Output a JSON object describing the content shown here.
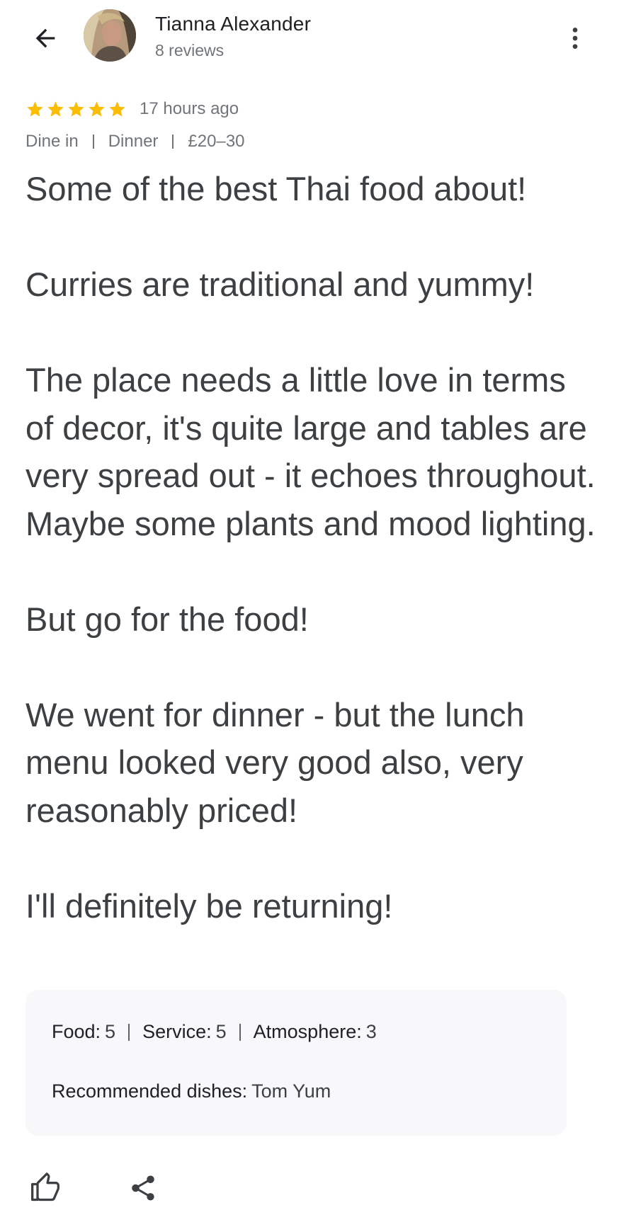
{
  "header": {
    "user_name": "Tianna Alexander",
    "review_count": "8 reviews",
    "back_icon": "arrow-left-icon",
    "more_icon": "more-vertical-icon"
  },
  "rating": {
    "stars": 5,
    "star_color": "#fbbc04",
    "time_ago": "17 hours ago"
  },
  "meta": {
    "items": [
      "Dine in",
      "Dinner",
      "£20–30"
    ]
  },
  "review": {
    "paragraphs": [
      "Some of the best Thai food about!",
      "Curries are traditional and yummy!",
      "The place needs a little love in terms of decor, it's quite large and tables are very spread out - it echoes throughout. Maybe some plants and mood lighting.",
      "But go for the food!",
      "We went for dinner - but the lunch menu looked very good also, very reasonably priced!",
      "I'll definitely be returning!"
    ]
  },
  "ratings_box": {
    "food_label": "Food:",
    "food_value": "5",
    "service_label": "Service:",
    "service_value": "5",
    "atmosphere_label": "Atmosphere:",
    "atmosphere_value": "3",
    "dishes_label": "Recommended dishes:",
    "dishes_value": "Tom Yum"
  },
  "actions": {
    "like_icon": "thumbs-up-icon",
    "share_icon": "share-icon"
  }
}
